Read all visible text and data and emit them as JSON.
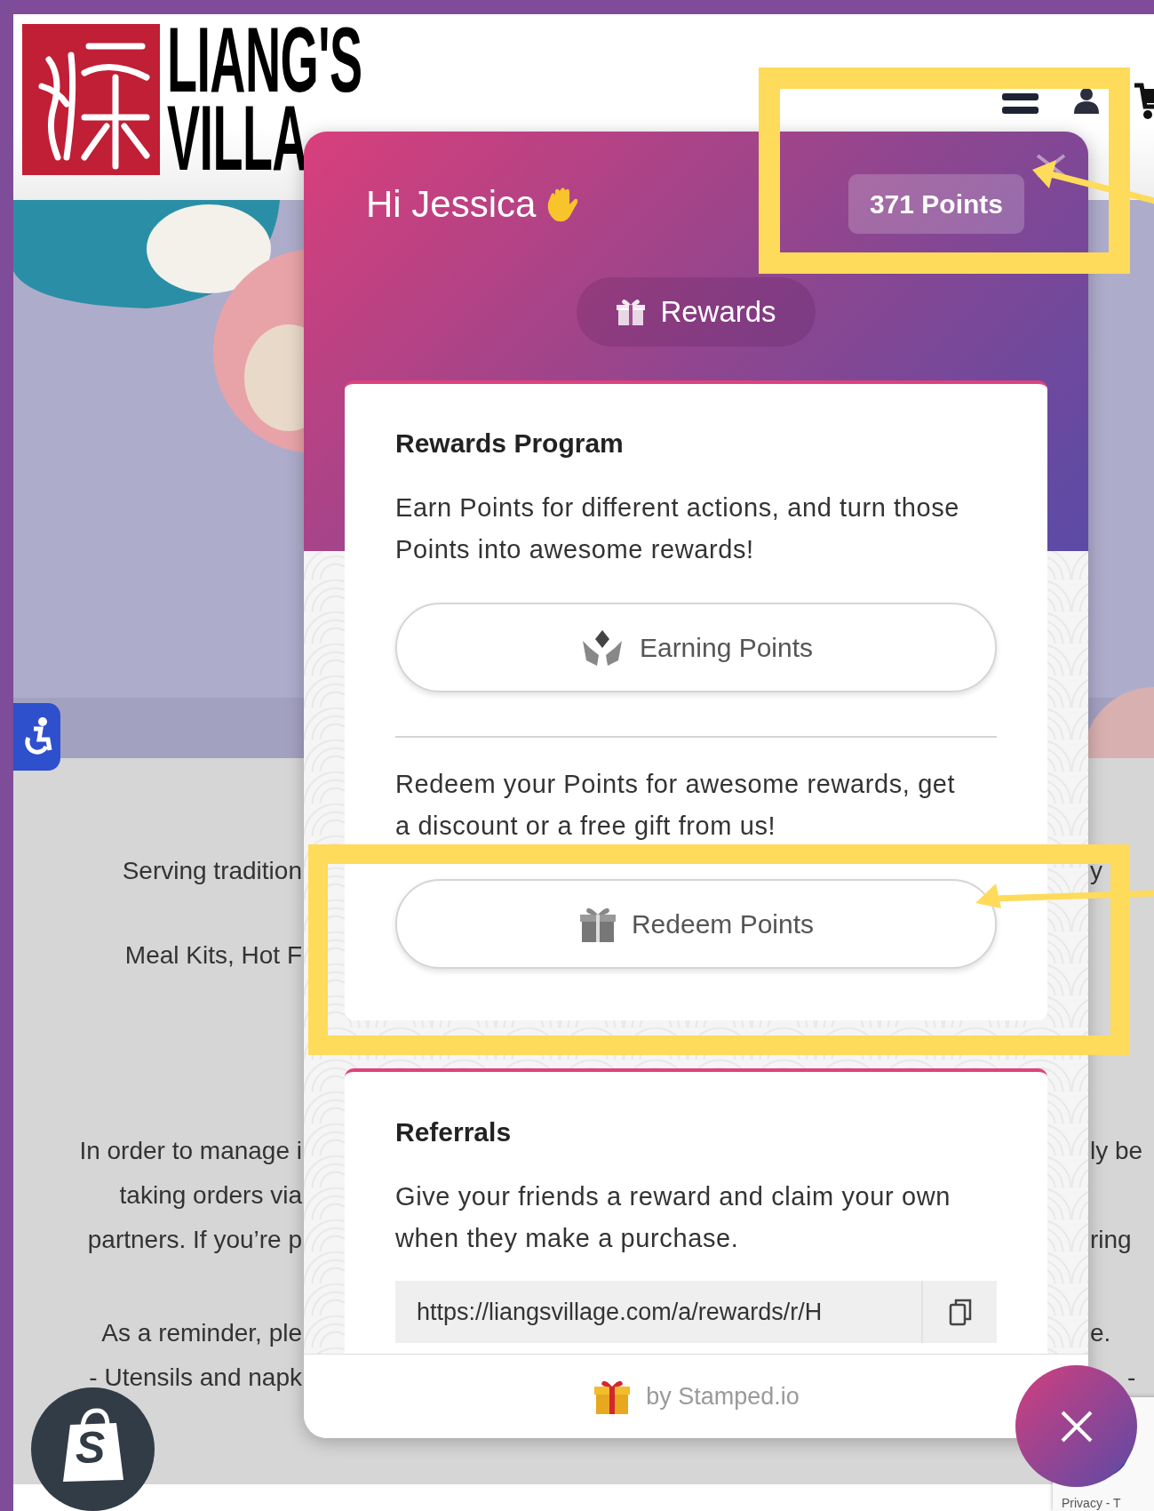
{
  "header": {
    "logo": {
      "lines": [
        "LIANG'S",
        "VILLA"
      ]
    }
  },
  "content_rows": [
    {
      "left": "Serving tradition",
      "right": "y"
    },
    {
      "left": "Meal Kits, Hot F"
    },
    {
      "left": "In order to manage i",
      "right": "ly be"
    },
    {
      "left": "taking orders via"
    },
    {
      "left": "partners. If you’re p",
      "right": "ring"
    },
    {
      "left": "As a reminder, ple",
      "right": "e."
    },
    {
      "left": "- Utensils and napk",
      "right": "-"
    }
  ],
  "widget": {
    "greeting": "Hi Jessica",
    "points": "371 Points",
    "tabs": [
      {
        "label": "Rewards",
        "selected": true
      }
    ],
    "cards": [
      {
        "title": "Rewards Program",
        "sections": [
          {
            "kind": "button",
            "text": "Earn Points for different actions, and turn those Points into awesome rewards!",
            "button": "Earning Points"
          },
          {
            "kind": "button",
            "text": "Redeem your Points for awesome rewards, get a discount or a free gift from us!",
            "button": "Redeem Points"
          }
        ]
      },
      {
        "title": "Referrals",
        "sections": [
          {
            "kind": "link",
            "text": "Give your friends a reward and claim your own when they make a purchase.",
            "link": "https://liangsvillage.com/a/rewards/r/H"
          }
        ]
      }
    ],
    "footer": "by Stamped.io"
  },
  "shop_badge": {
    "letter": "S"
  },
  "recaptcha": {
    "links": "Privacy - T"
  }
}
